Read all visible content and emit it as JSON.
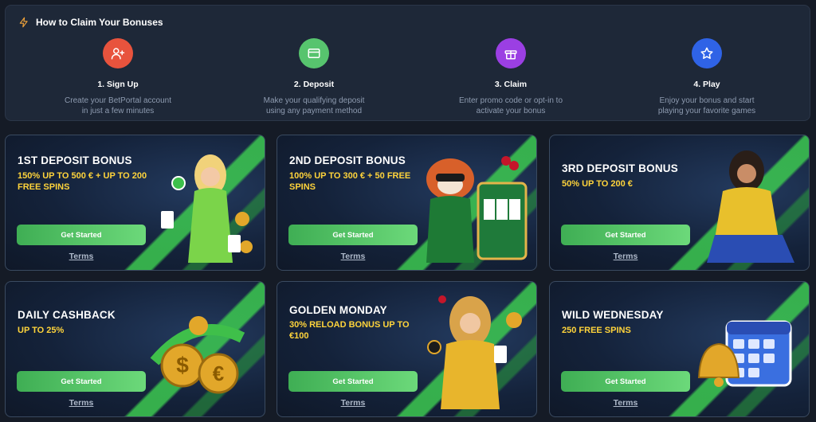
{
  "steps_panel": {
    "title": "How to Claim Your Bonuses",
    "icon": "lightning-icon",
    "steps": [
      {
        "title": "1. Sign Up",
        "desc": "Create your BetPortal account in just a few minutes",
        "icon": "user-plus-icon",
        "color": "#e8533d"
      },
      {
        "title": "2. Deposit",
        "desc": "Make your qualifying deposit using any payment method",
        "icon": "credit-card-icon",
        "color": "#57c46e"
      },
      {
        "title": "3. Claim",
        "desc": "Enter promo code or opt-in to activate your bonus",
        "icon": "gift-icon",
        "color": "#9b3fe3"
      },
      {
        "title": "4. Play",
        "desc": "Enjoy your bonus and start playing your favorite games",
        "icon": "star-icon",
        "color": "#2f63e6"
      }
    ]
  },
  "bonuses": [
    {
      "title": "1ST DEPOSIT BONUS",
      "subtitle": "150% UP TO 500 € + UP TO 200 FREE SPINS",
      "button": "Get Started",
      "terms": "Terms",
      "art": "woman-green-dress-chips"
    },
    {
      "title": "2ND DEPOSIT BONUS",
      "subtitle": "100% UP TO 300 € + 50 FREE SPINS",
      "button": "Get Started",
      "terms": "Terms",
      "art": "red-panda-slot-machine"
    },
    {
      "title": "3RD DEPOSIT BONUS",
      "subtitle": "50% UP TO 200 €",
      "button": "Get Started",
      "terms": "Terms",
      "art": "woman-yellow-jacket"
    },
    {
      "title": "DAILY CASHBACK",
      "subtitle": "UP TO 25%",
      "button": "Get Started",
      "terms": "Terms",
      "art": "gold-coins-cashback"
    },
    {
      "title": "GOLDEN MONDAY",
      "subtitle": "30% RELOAD BONUS UP TO €100",
      "button": "Get Started",
      "terms": "Terms",
      "art": "woman-gold-dress-cards"
    },
    {
      "title": "WILD WEDNESDAY",
      "subtitle": "250 FREE SPINS",
      "button": "Get Started",
      "terms": "Terms",
      "art": "calendar-bell"
    }
  ]
}
